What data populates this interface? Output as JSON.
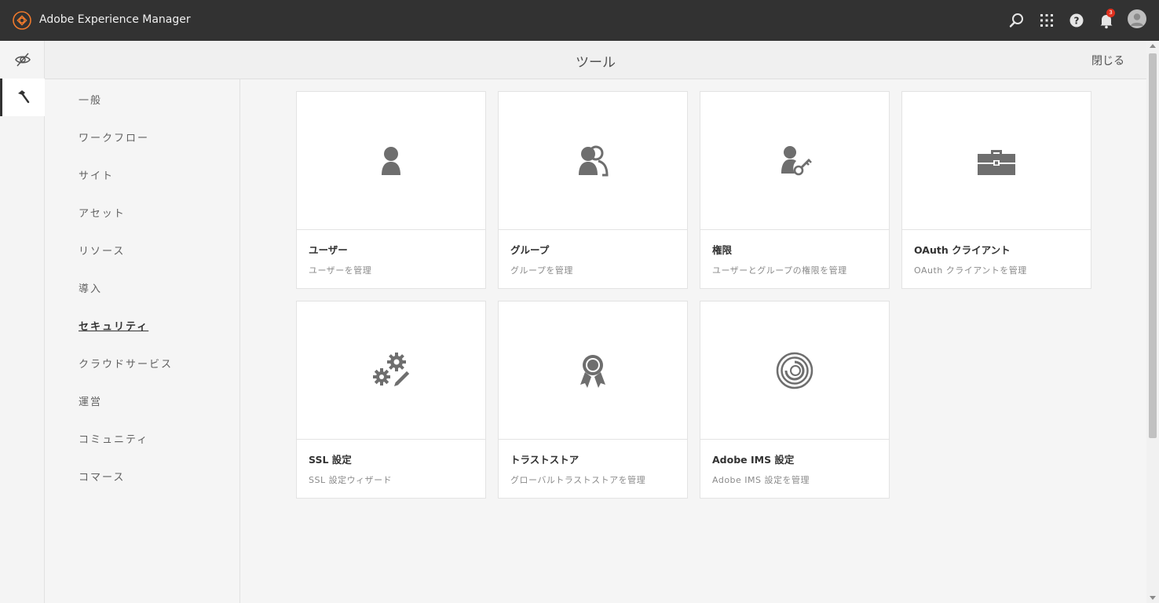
{
  "topbar": {
    "app_title": "Adobe Experience Manager",
    "notification_count": "3",
    "icons": [
      "adobe-logo-icon",
      "search-icon",
      "apps-grid-icon",
      "help-icon",
      "bell-icon",
      "user-avatar-icon"
    ]
  },
  "rail": {
    "items": [
      {
        "icon": "eye-off-icon"
      },
      {
        "icon": "hammer-icon"
      }
    ]
  },
  "header": {
    "title": "ツール",
    "close_label": "閉じる"
  },
  "categories": [
    {
      "label": "一般"
    },
    {
      "label": "ワークフロー"
    },
    {
      "label": "サイト"
    },
    {
      "label": "アセット"
    },
    {
      "label": "リソース"
    },
    {
      "label": "導入"
    },
    {
      "label": "セキュリティ"
    },
    {
      "label": "クラウドサービス"
    },
    {
      "label": "運営"
    },
    {
      "label": "コミュニティ"
    },
    {
      "label": "コマース"
    }
  ],
  "active_category": "セキュリティ",
  "cards": [
    {
      "title": "ユーザー",
      "description": "ユーザーを管理",
      "icon": "user-icon"
    },
    {
      "title": "グループ",
      "description": "グループを管理",
      "icon": "group-icon"
    },
    {
      "title": "権限",
      "description": "ユーザーとグループの権限を管理",
      "icon": "user-key-icon"
    },
    {
      "title": "OAuth クライアント",
      "description": "OAuth クライアントを管理",
      "icon": "toolbox-icon"
    },
    {
      "title": "SSL 設定",
      "description": "SSL 設定ウィザード",
      "icon": "gears-pencil-icon"
    },
    {
      "title": "トラストストア",
      "description": "グローバルトラストストアを管理",
      "icon": "ribbon-badge-icon"
    },
    {
      "title": "Adobe IMS 設定",
      "description": "Adobe IMS 設定を管理",
      "icon": "target-rings-icon"
    }
  ],
  "colors": {
    "topbar_bg": "#323232",
    "badge": "#e0301e",
    "logo_accent": "#f07a2c",
    "icon_gray": "#6e6e6e"
  }
}
